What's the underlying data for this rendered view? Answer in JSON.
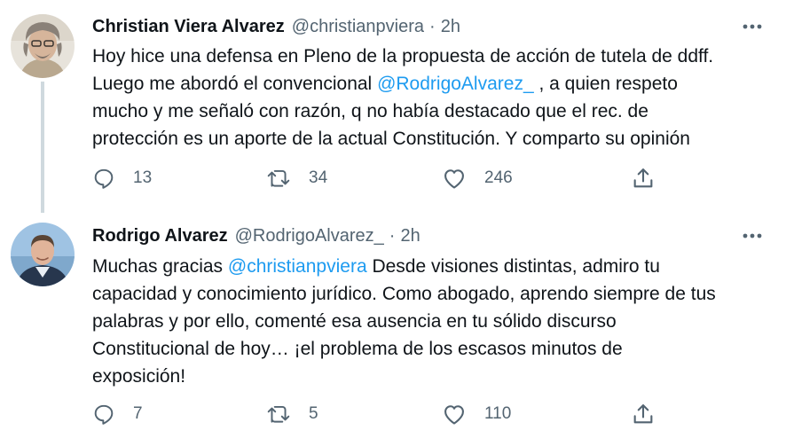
{
  "tweets": [
    {
      "name": "Christian Viera Alvarez",
      "handle": "@christianpviera",
      "separator": "·",
      "time": "2h",
      "text_lines": [
        [
          "Hoy hice una defensa en Pleno de la propuesta de acción de tutela de ddff."
        ],
        [
          "Luego me abordó el convencional ",
          "@RodrigoAlvarez_",
          " , a quien respeto"
        ],
        [
          "mucho y me señaló con razón, q no había destacado que el rec. de"
        ],
        [
          "protección es un aporte de la actual Constitución. Y comparto su opinión"
        ]
      ],
      "replies": "13",
      "retweets": "34",
      "likes": "246"
    },
    {
      "name": "Rodrigo Alvarez",
      "handle": "@RodrigoAlvarez_",
      "separator": "·",
      "time": "2h",
      "text_lines": [
        [
          "Muchas gracias ",
          "@christianpviera",
          " Desde visiones distintas, admiro tu"
        ],
        [
          "capacidad y conocimiento jurídico. Como abogado, aprendo siempre de tus"
        ],
        [
          "palabras y por ello, comenté esa ausencia en tu sólido discurso"
        ],
        [
          "Constitucional de hoy… ¡el problema de los escasos minutos de"
        ],
        [
          "exposición!"
        ]
      ],
      "replies": "7",
      "retweets": "5",
      "likes": "110"
    }
  ],
  "icons": {
    "reply": "reply-icon",
    "retweet": "retweet-icon",
    "like": "heart-icon",
    "share": "share-icon",
    "more": "more-options-icon"
  },
  "colors": {
    "text": "#0f1419",
    "secondary": "#536471",
    "link": "#1d9bf0",
    "thread_line": "#cfd9de"
  }
}
